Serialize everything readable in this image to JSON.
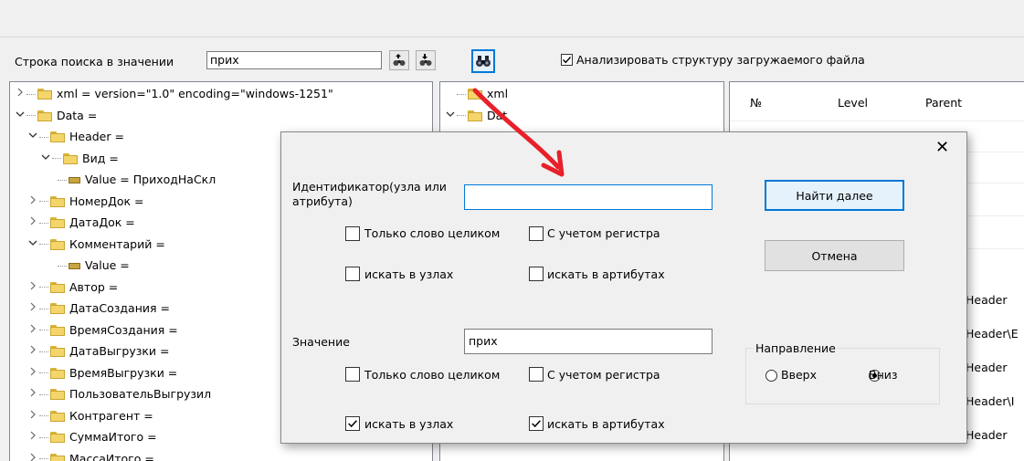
{
  "toolbar": {
    "search_label": "Строка поиска в значении",
    "search_value": "прих",
    "analyze_label": "Анализировать структуру загружаемого файла",
    "analyze_checked": true
  },
  "tree_left": [
    {
      "text": "xml = version=\"1.0\" encoding=\"windows-1251\"",
      "chev": ">"
    },
    {
      "text": "Data =",
      "chev": "v"
    },
    {
      "text": "Header =",
      "chev": "v"
    },
    {
      "text": "Вид =",
      "chev": "v"
    },
    {
      "text": "Value = ПриходНаСкл",
      "chev": ""
    },
    {
      "text": "НомерДок =",
      "chev": ">"
    },
    {
      "text": "ДатаДок =",
      "chev": ">"
    },
    {
      "text": "Комментарий =",
      "chev": "v"
    },
    {
      "text": "Value =",
      "chev": ""
    },
    {
      "text": "Автор =",
      "chev": ">"
    },
    {
      "text": "ДатаСоздания =",
      "chev": ">"
    },
    {
      "text": "ВремяСоздания =",
      "chev": ">"
    },
    {
      "text": "ДатаВыгрузки =",
      "chev": ">"
    },
    {
      "text": "ВремяВыгрузки =",
      "chev": ">"
    },
    {
      "text": "ПользовательВыгрузил",
      "chev": ">"
    },
    {
      "text": "Контрагент =",
      "chev": ">"
    },
    {
      "text": "СуммаИтого =",
      "chev": ">"
    },
    {
      "text": "МассаИтого =",
      "chev": ">"
    }
  ],
  "tree_mid": [
    {
      "text": "xml",
      "chev": ""
    },
    {
      "text": "Dat",
      "chev": "v"
    }
  ],
  "grid": {
    "headers": [
      "№",
      "Level",
      "Parent"
    ],
    "parent_cells": [
      "Header",
      "Header\\E",
      "Header",
      "Header\\I",
      "Header"
    ]
  },
  "dialog": {
    "close_glyph": "✕",
    "id_label": "Идентификатор(узла или атрибута)",
    "id_value": "",
    "whole_word_1": "Только слово целиком",
    "case_1": "С учетом регистра",
    "nodes_1": "искать в узлах",
    "attrs_1": "искать в артибутах",
    "value_label": "Значение",
    "value_value": "прих",
    "whole_word_2": "Только слово целиком",
    "case_2": "С учетом регистра",
    "nodes_2": "искать в узлах",
    "attrs_2": "искать в артибутах",
    "find_next": "Найти далее",
    "cancel": "Отмена",
    "direction_label": "Направление",
    "up": "Вверх",
    "down": "Вниз",
    "checks": {
      "whole1": false,
      "case1": false,
      "nodes1": false,
      "attrs1": false,
      "whole2": false,
      "case2": false,
      "nodes2": true,
      "attrs2": true
    },
    "direction": "down"
  },
  "colors": {
    "accent": "#0078d7",
    "arrow": "#e8202a"
  }
}
